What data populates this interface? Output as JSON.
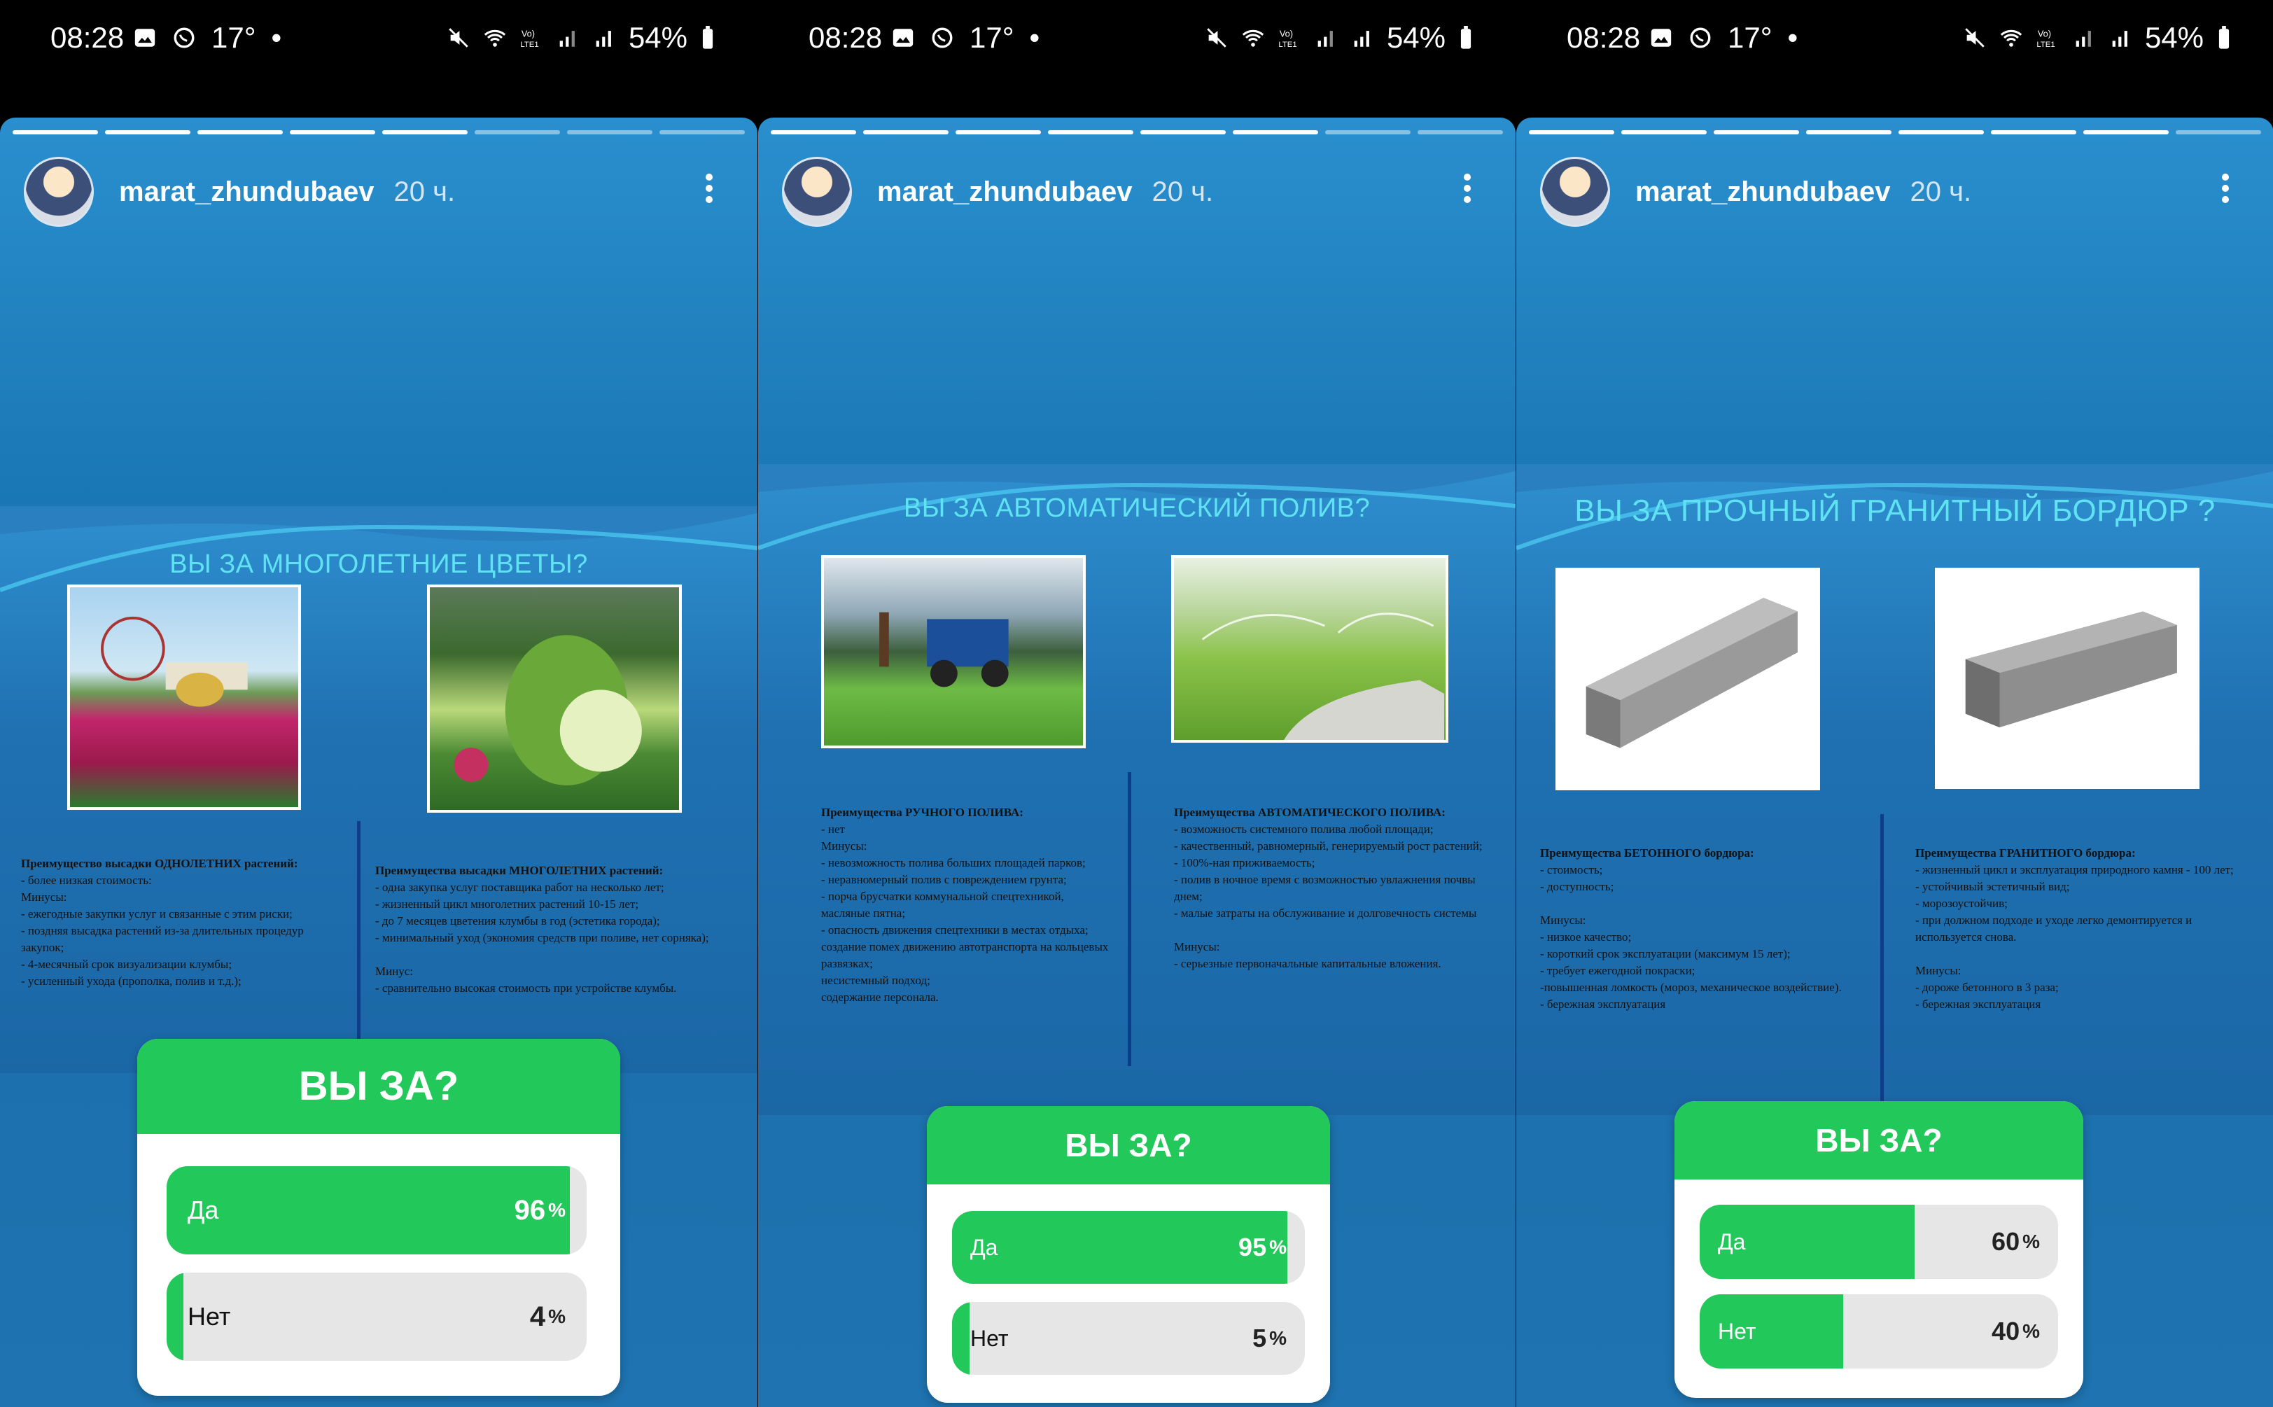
{
  "statusbar": {
    "time": "08:28",
    "temp": "17°",
    "dot": "•",
    "battery": "54%"
  },
  "story": {
    "username": "marat_zhundubaev",
    "ago": "20 ч."
  },
  "stories": [
    {
      "title": "ВЫ ЗА МНОГОЛЕТНИЕ  ЦВЕТЫ?",
      "left_text_title": "Преимущество высадки ОДНОЛЕТНИХ растений:",
      "left_text": "- более низкая стоимость:\nМинусы:\n- ежегодные закупки услуг и связанные с этим риски;\n-  поздняя высадка растений из-за длительных процедур закупок;\n- 4-месячный срок визуализации  клумбы;\n- усиленный  ухода (прополка, полив и т.д.);",
      "right_text_title": "Преимущества высадки МНОГОЛЕТНИХ растений:",
      "right_text": "- одна закупка услуг поставщика работ на несколько лет;\n- жизненный цикл многолетних растений 10-15 лет;\n- до 7 месяцев цветения клумбы в год (эстетика города);\n- минимальный уход (экономия средств при поливе, нет сорняка);\n\nМинус:\n- сравнительно высокая стоимость при устройстве клумбы.",
      "poll_question": "ВЫ ЗА?",
      "options": [
        {
          "label": "Да",
          "percent": 96
        },
        {
          "label": "Нет",
          "percent": 4
        }
      ],
      "progress_done": 5,
      "progress_total": 8
    },
    {
      "title": "ВЫ ЗА АВТОМАТИЧЕСКИЙ ПОЛИВ?",
      "left_text_title": "Преимущества РУЧНОГО ПОЛИВА:",
      "left_text": "- нет\nМинусы:\n- невозможность полива больших площадей парков;\n- неравномерный полив с повреждением грунта;\n- порча брусчатки коммунальной спецтехникой, масляные пятна;\n- опасность движения спецтехники в местах отдыха;\n  создание помех движению автотранспорта на кольцевых развязках;\n  несистемный подход;\n  содержание  персонала.",
      "right_text_title": "Преимущества АВТОМАТИЧЕСКОГО ПОЛИВА:",
      "right_text": "- возможность  системного полива любой площади;\n- качественный, равномерный, генерируемый рост растений;\n- 100%-ная приживаемость;\n- полив в ночное время с возможностью увлажнения почвы днем;\n- малые затраты на обслуживание и долговечность системы\n\nМинусы:\n- серьезные первоначальные капитальные вложения.",
      "poll_question": "ВЫ ЗА?",
      "options": [
        {
          "label": "Да",
          "percent": 95
        },
        {
          "label": "Нет",
          "percent": 5
        }
      ],
      "progress_done": 6,
      "progress_total": 8
    },
    {
      "title": "ВЫ ЗА ПРОЧНЫЙ ГРАНИТНЫЙ БОРДЮР ?",
      "left_text_title": "Преимущества БЕТОННОГО бордюра:",
      "left_text": "- стоимость;\n- доступность;\n\nМинусы:\n- низкое качество;\n- короткий срок эксплуатации (максимум 15 лет);\n- требует ежегодной покраски;\n-повышенная ломкость (мороз, механическое воздействие).\n- бережная эксплуатация",
      "right_text_title": "Преимущества ГРАНИТНОГО бордюра:",
      "right_text": "- жизненный цикл и эксплуатация природного камня - 100 лет;\n-  устойчивый эстетичный вид;\n- морозоустойчив;\n- при должном подходе и уходе легко демонтируется и используется снова.\n\nМинусы:\n-  дороже бетонного в 3 раза;\n- бережная эксплуатация",
      "poll_question": "ВЫ ЗА?",
      "options": [
        {
          "label": "Да",
          "percent": 60
        },
        {
          "label": "Нет",
          "percent": 40
        }
      ],
      "progress_done": 7,
      "progress_total": 8
    }
  ],
  "colors": {
    "poll_green": "#22c85a",
    "slide_blue": "#1f71b2",
    "title_cyan": "#5fe3f2"
  }
}
